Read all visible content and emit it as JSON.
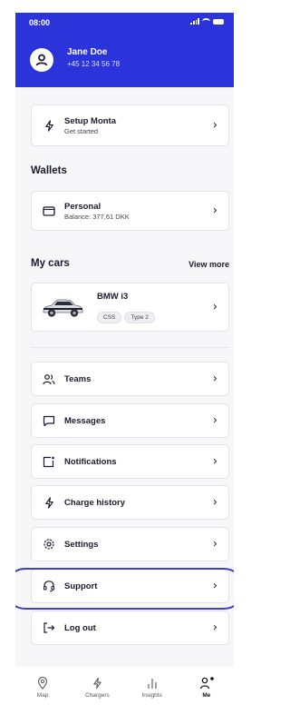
{
  "status_bar": {
    "time": "08:00"
  },
  "profile": {
    "name": "Jane Doe",
    "phone": "+45 12 34 56 78"
  },
  "setup": {
    "title": "Setup Monta",
    "subtitle": "Get started"
  },
  "wallets": {
    "heading": "Wallets",
    "items": [
      {
        "title": "Personal",
        "subtitle": "Balance: 377,61 DKK"
      }
    ]
  },
  "cars": {
    "heading": "My cars",
    "view_more": "View more",
    "items": [
      {
        "name": "BMW i3",
        "tags": [
          "CSS",
          "Type 2"
        ]
      }
    ]
  },
  "menu": [
    {
      "label": "Teams",
      "icon": "people-icon"
    },
    {
      "label": "Messages",
      "icon": "message-icon"
    },
    {
      "label": "Notifications",
      "icon": "notification-icon"
    },
    {
      "label": "Charge history",
      "icon": "lightning-icon"
    },
    {
      "label": "Settings",
      "icon": "gear-icon"
    },
    {
      "label": "Support",
      "icon": "headset-icon"
    },
    {
      "label": "Log out",
      "icon": "logout-icon"
    }
  ],
  "tabbar": [
    {
      "label": "Map",
      "icon": "map-pin-icon"
    },
    {
      "label": "Chargers",
      "icon": "lightning-icon"
    },
    {
      "label": "Insights",
      "icon": "bar-chart-icon"
    },
    {
      "label": "Me",
      "icon": "profile-icon",
      "active": true
    }
  ],
  "colors": {
    "brand": "#2b33db",
    "highlight": "#3b3fd4"
  }
}
